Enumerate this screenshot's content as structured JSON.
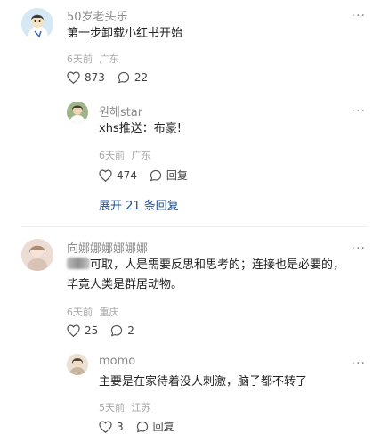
{
  "comments": [
    {
      "username": "50岁老头乐",
      "text": "第一步卸载小红书开始",
      "time": "6天前",
      "location": "广东",
      "likes": "873",
      "replies": "22",
      "reply": {
        "username": "원해star",
        "text": "xhs推送：布豪!",
        "time": "6天前",
        "location": "广东",
        "likes": "474",
        "reply_label": "回复"
      },
      "expand_label": "展开 21 条回复"
    },
    {
      "username": "向娜娜娜娜娜娜",
      "text_line1": "可取，人是需要反思和思考的；连接也是必要的，",
      "text_line2": "毕竟人类是群居动物。",
      "time": "6天前",
      "location": "重庆",
      "likes": "25",
      "replies": "2",
      "reply": {
        "username": "momo",
        "text": "主要是在家待着没人刺激，脑子都不转了",
        "time": "5天前",
        "location": "江苏",
        "likes": "3",
        "reply_label": "回复"
      }
    }
  ],
  "more_glyph": "···",
  "icons": [
    "heart-icon",
    "comment-icon",
    "more-icon"
  ]
}
